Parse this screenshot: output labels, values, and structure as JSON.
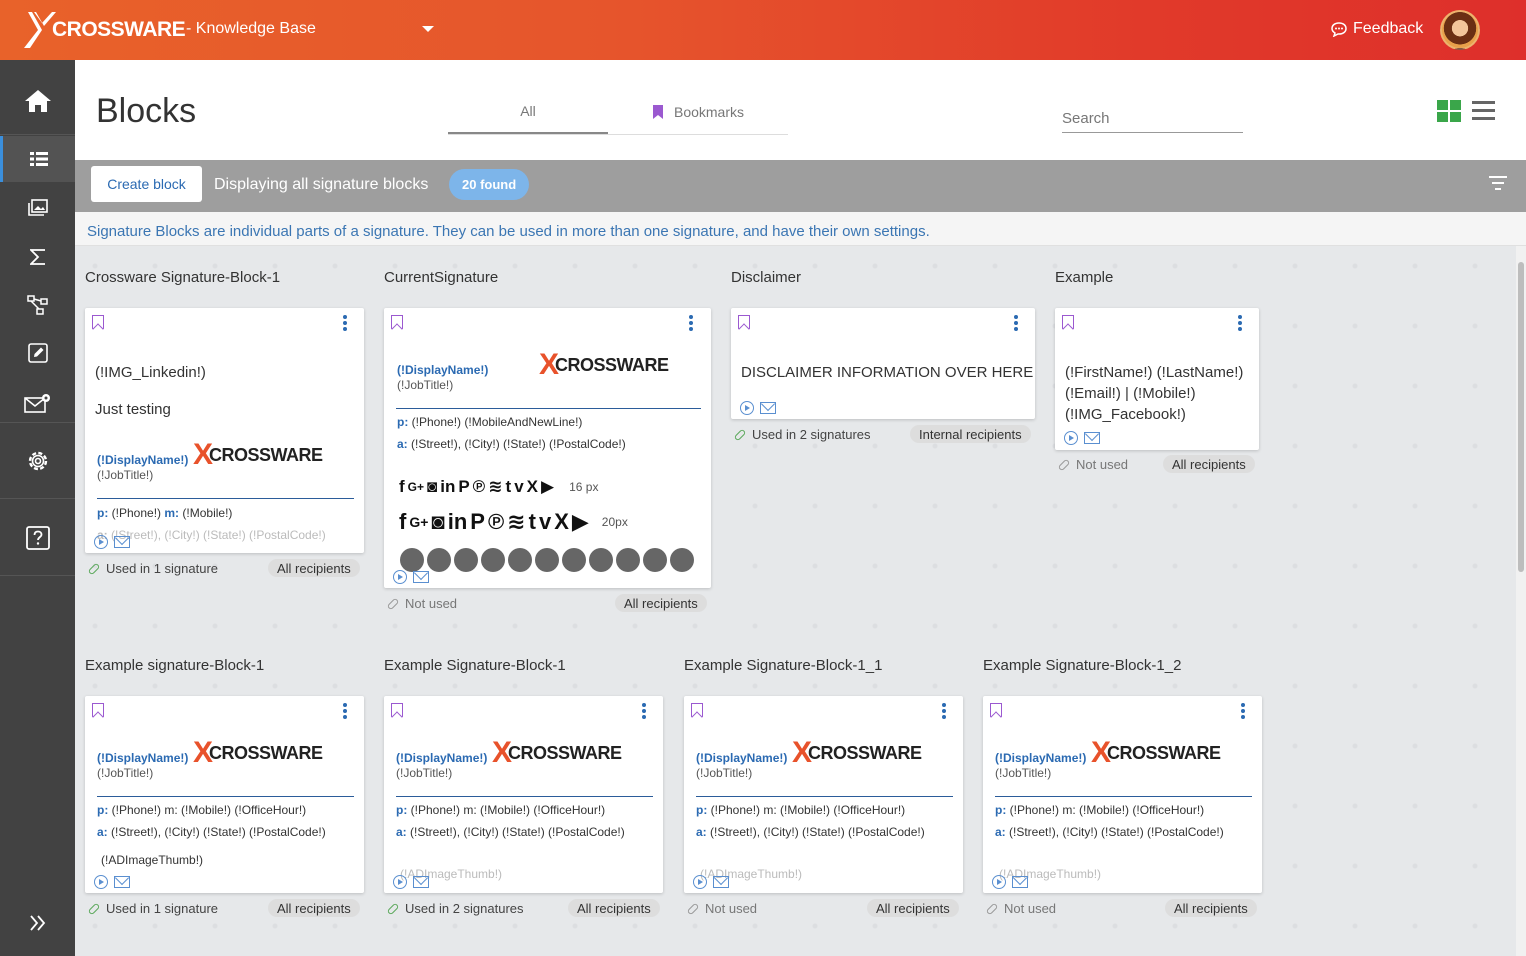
{
  "header": {
    "logo_text": "CROSSWARE",
    "kb_title": "- Knowledge Base",
    "feedback_label": "Feedback"
  },
  "sidebar": {
    "items": [
      "home-icon",
      "blocks-icon",
      "gallery-icon",
      "sigma-icon",
      "rules-icon",
      "edit-icon",
      "mail-settings-icon",
      "settings-icon",
      "help-icon",
      "expand-icon"
    ]
  },
  "page": {
    "title": "Blocks",
    "tabs": [
      {
        "label": "All"
      },
      {
        "label": "Bookmarks"
      }
    ],
    "search_placeholder": "Search"
  },
  "toolbar": {
    "create_label": "Create block",
    "display_text": "Displaying all signature blocks",
    "found_label": "20 found"
  },
  "info": "Signature Blocks are individual parts of a signature. They can be used in more than one signature, and have their own settings.",
  "sig": {
    "display_name": "(!DisplayName!)",
    "job_title": "(!JobTitle!)",
    "logo_word": "CROSSWARE",
    "phone_label": "p:",
    "phone_mobile": "(!Phone!)",
    "m_label": "m:",
    "mobile": "(!Mobile!)",
    "phone_officehour": "(!Phone!) m: (!Mobile!)  (!OfficeHour!)",
    "addr_label": "a:",
    "address": "(!Street!), (!City!) (!State!) (!PostalCode!)",
    "phone_mobile_newline": "(!Phone!)  (!MobileAndNewLine!)",
    "ad_thumb": "(!ADImageThumb!)",
    "ad_thumb_faded": "(!ADImageThumb!)"
  },
  "blocks": [
    {
      "title": "Crossware Signature-Block-1",
      "line1": "(!IMG_Linkedin!)",
      "line2": "Just testing",
      "used": "Used in 1 signature",
      "recipients": "All recipients"
    },
    {
      "title": "CurrentSignature",
      "px16": "16 px",
      "px20": "20px",
      "used": "Not used",
      "recipients": "All recipients"
    },
    {
      "title": "Disclaimer",
      "line1": "DISCLAIMER INFORMATION OVER HERE",
      "used": "Used in 2 signatures",
      "recipients": "Internal recipients"
    },
    {
      "title": "Example",
      "line1": "(!FirstName!) (!LastName!)",
      "line2": "(!Email!) | (!Mobile!)",
      "line3": "(!IMG_Facebook!)",
      "used": "Not used",
      "recipients": "All recipients"
    },
    {
      "title": "Example signature-Block-1",
      "used": "Used in 1 signature",
      "recipients": "All recipients"
    },
    {
      "title": "Example Signature-Block-1",
      "used": "Used in 2 signatures",
      "recipients": "All recipients"
    },
    {
      "title": "Example Signature-Block-1_1",
      "used": "Not used",
      "recipients": "All recipients"
    },
    {
      "title": "Example Signature-Block-1_2",
      "used": "Not used",
      "recipients": "All recipients"
    }
  ],
  "colors": {
    "accent": "#2b6ab2",
    "brand_orange": "#e8522b",
    "bookmark": "#9b59d0",
    "badge": "#7db5ea"
  }
}
